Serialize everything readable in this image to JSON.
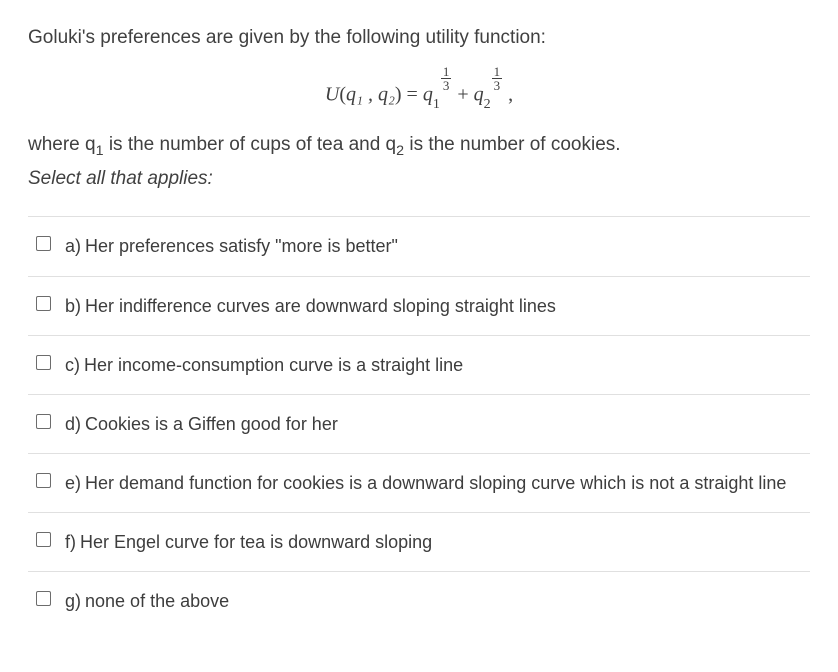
{
  "question": {
    "intro": "Goluki's preferences are given by the following utility function:",
    "equation": {
      "lhs_func": "U",
      "lhs_args": "q₁ , q₂",
      "rhs_term1_base": "q",
      "rhs_term1_sub": "1",
      "rhs_term2_base": "q",
      "rhs_term2_sub": "2",
      "exponent_num": "1",
      "exponent_den": "3"
    },
    "desc_part1": "where q",
    "desc_sub1": "1",
    "desc_part2": " is the number of cups of tea and q",
    "desc_sub2": "2",
    "desc_part3": " is the number of cookies.",
    "select_all": "Select all that applies:"
  },
  "options": [
    {
      "letter": "a)",
      "text": "Her preferences satisfy \"more is better\""
    },
    {
      "letter": "b)",
      "text": "Her indifference curves are downward sloping straight lines"
    },
    {
      "letter": "c)",
      "text": "Her income-consumption curve is a straight line"
    },
    {
      "letter": "d)",
      "text": "Cookies is a Giffen good for her"
    },
    {
      "letter": "e)",
      "text": "Her demand function for cookies is a downward sloping curve which is not a straight line"
    },
    {
      "letter": "f)",
      "text": "Her Engel curve for tea is downward sloping"
    },
    {
      "letter": "g)",
      "text": "none of the above"
    }
  ]
}
